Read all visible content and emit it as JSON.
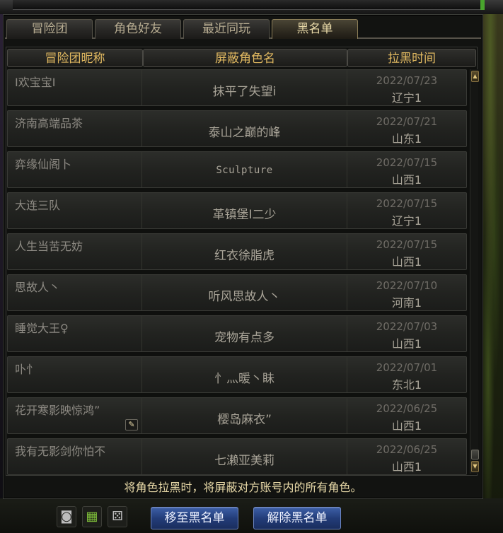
{
  "tabs": [
    {
      "label": "冒险团"
    },
    {
      "label": "角色好友"
    },
    {
      "label": "最近同玩"
    },
    {
      "label": "黑名单"
    }
  ],
  "active_tab": "黑名单",
  "table": {
    "columns": [
      "冒险团昵称",
      "屏蔽角色名",
      "拉黑时间"
    ],
    "rows": [
      {
        "nickname": "I欢宝宝I",
        "role": "抹平了失望i",
        "date": "2022/07/23",
        "region": "辽宁1"
      },
      {
        "nickname": "济南高端品茶",
        "role": "泰山之巅的峰",
        "date": "2022/07/21",
        "region": "山东1"
      },
      {
        "nickname": "弈缘仙阁卜",
        "role": "Sculpture",
        "date": "2022/07/15",
        "region": "山西1"
      },
      {
        "nickname": "大连三队",
        "role": "革镇堡I二少",
        "date": "2022/07/15",
        "region": "辽宁1"
      },
      {
        "nickname": " 人生当苦无妨",
        "role": "红衣徐脂虎",
        "date": "2022/07/15",
        "region": "山西1"
      },
      {
        "nickname": "思故人丶",
        "role": "听风思故人丶",
        "date": "2022/07/10",
        "region": "河南1"
      },
      {
        "nickname": "睡觉大王♀",
        "role": "宠物有点多",
        "date": "2022/07/03",
        "region": "山西1"
      },
      {
        "nickname": "卟忄",
        "role": "忄灬暖丶眛",
        "date": "2022/07/01",
        "region": "东北1"
      },
      {
        "nickname": "花开寒影映惊鸿”",
        "role": "樱岛麻衣”",
        "date": "2022/06/25",
        "region": "山西1"
      },
      {
        "nickname": "我有无影剑你怕不",
        "role": "七濑亚美莉",
        "date": "2022/06/25",
        "region": "山西1"
      }
    ]
  },
  "notice": "将角色拉黑时，将屏蔽对方账号内的所有角色。",
  "buttons": {
    "move_to_blacklist": "移至黑名单",
    "remove_blacklist": "解除黑名单"
  },
  "icons": {
    "edit": "edit-icon",
    "scroll_up": "scroll-up-icon",
    "scroll_down": "scroll-down-icon",
    "tool_1": "camera-icon",
    "tool_2": "calendar-icon",
    "tool_3": "dice-icon"
  },
  "colors": {
    "header_text": "#e0b860",
    "notice_text": "#e7d8a7",
    "button_blue": "#233d79"
  }
}
